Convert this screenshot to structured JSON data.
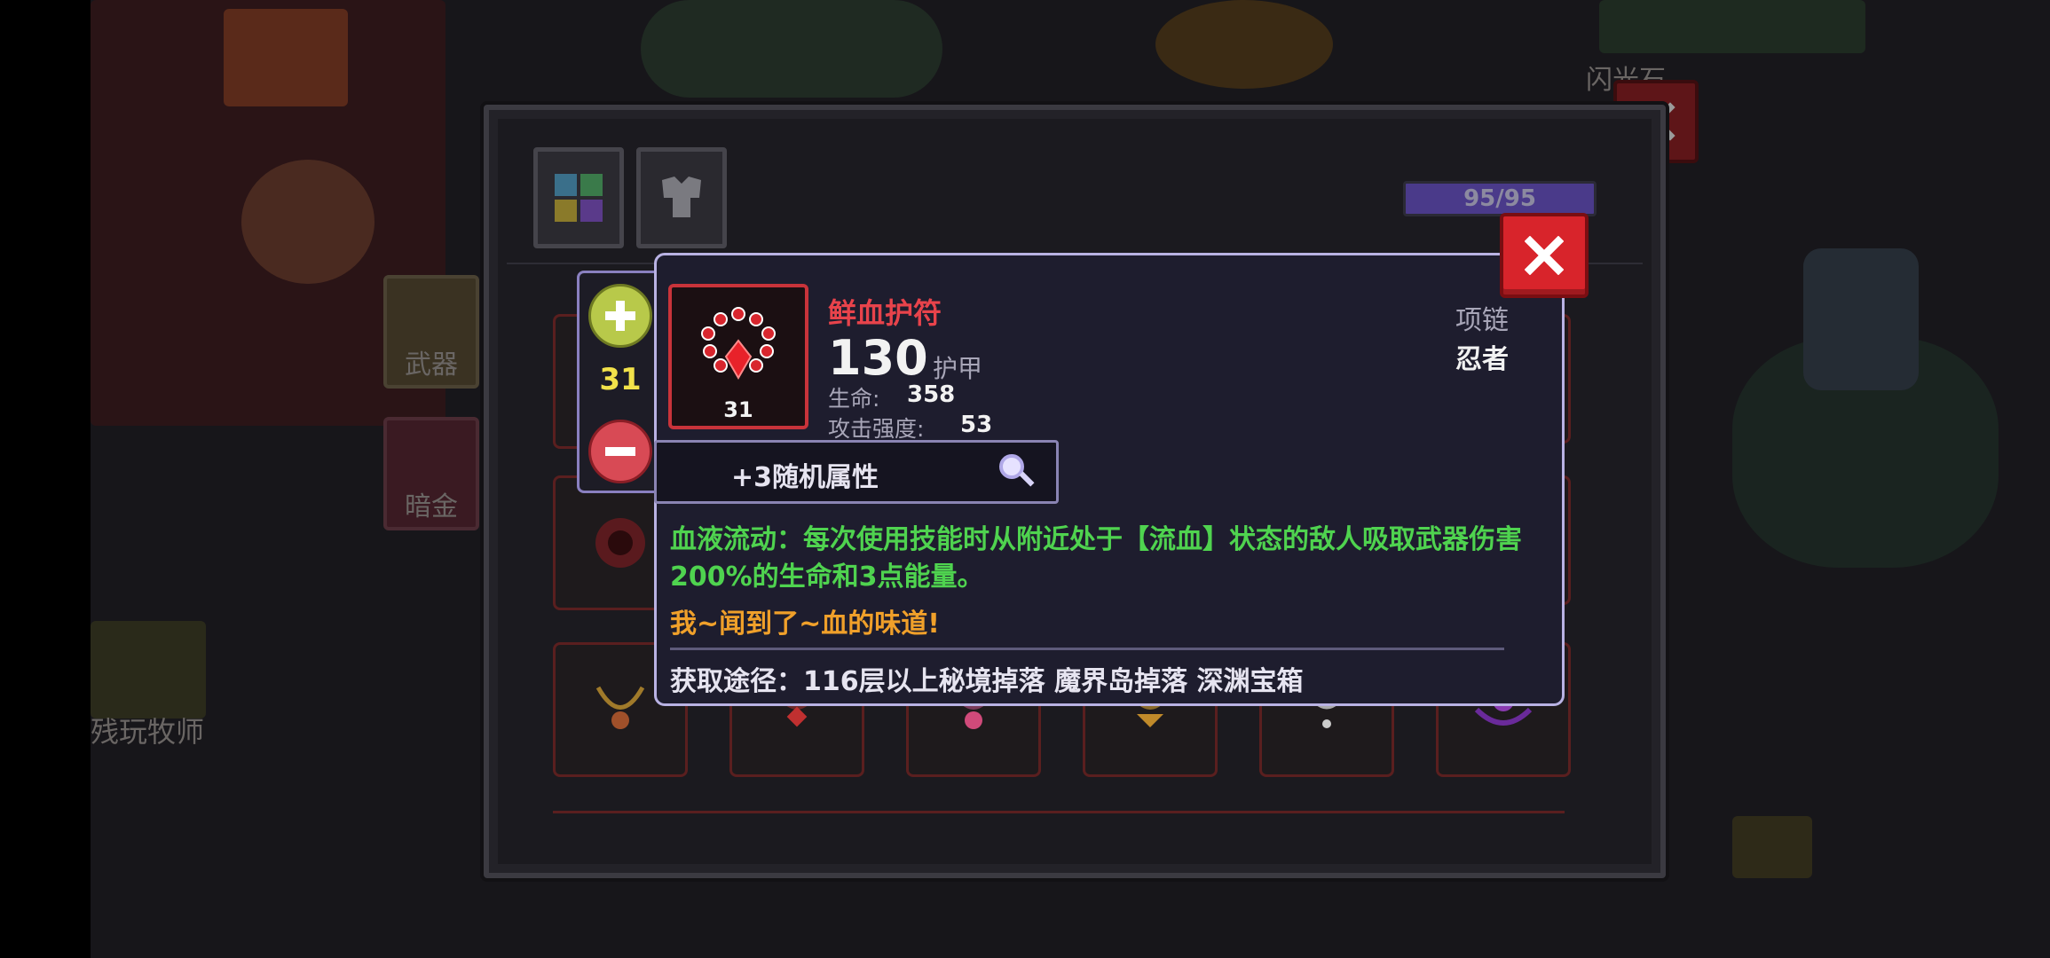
{
  "background": {
    "left_labels": [
      "武器",
      "暗金"
    ],
    "player_name": "残玩牧师",
    "top_right_label": "闪光石"
  },
  "panel": {
    "energy_text": "95/95"
  },
  "quantity": {
    "value": "31"
  },
  "tooltip": {
    "item_name": "鲜血护符",
    "item_level": "31",
    "armor_value": "130",
    "armor_label": "护甲",
    "stat1_label": "生命:",
    "stat1_value": "358",
    "stat2_label": "攻击强度:",
    "stat2_value": "53",
    "category": "项链",
    "class": "忍者",
    "random_attr": "+3随机属性",
    "skill_text": "血液流动：每次使用技能时从附近处于【流血】状态的敌人吸取武器伤害200%的生命和3点能量。",
    "flavor_text": "我~闻到了~血的味道!",
    "source_text": "获取途径：116层以上秘境掉落 魔界岛掉落 深渊宝箱"
  },
  "colors": {
    "item_name": "#e8434b",
    "skill_text": "#4fd34f",
    "flavor_text": "#f0a02a",
    "close_red": "#d8242b",
    "tooltip_border": "#b9b2e3"
  }
}
